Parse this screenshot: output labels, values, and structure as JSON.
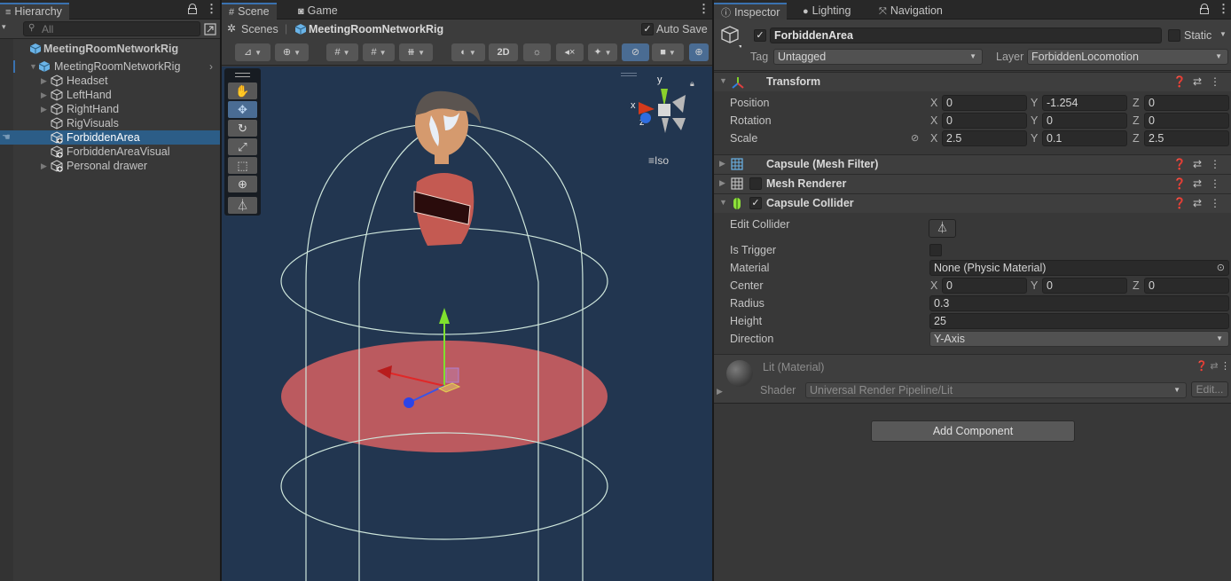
{
  "hierarchy": {
    "tab_label": "Hierarchy",
    "search_placeholder": "All",
    "scene_root": "MeetingRoomNetworkRig",
    "items": [
      {
        "label": "MeetingRoomNetworkRig",
        "expanded": true,
        "prefab": true
      },
      {
        "label": "Headset",
        "collapsed": true,
        "prefab": true
      },
      {
        "label": "LeftHand",
        "collapsed": true,
        "prefab": true
      },
      {
        "label": "RightHand",
        "collapsed": true,
        "prefab": true
      },
      {
        "label": "RigVisuals",
        "prefab": true
      },
      {
        "label": "ForbiddenArea",
        "selected": true,
        "added": true
      },
      {
        "label": "ForbiddenAreaVisual",
        "added": true
      },
      {
        "label": "Personal drawer",
        "collapsed": true,
        "added": true
      }
    ]
  },
  "scene": {
    "tabs": [
      {
        "label": "Scene",
        "icon": "grid-icon",
        "active": true
      },
      {
        "label": "Game",
        "icon": "gamepad-icon",
        "active": false
      }
    ],
    "breadcrumb": {
      "scenes": "Scenes",
      "prefab": "MeetingRoomNetworkRig"
    },
    "auto_save_label": "Auto Save",
    "auto_save_checked": true,
    "toolbar": {
      "mode_2d": "2D"
    },
    "gizmo": {
      "x": "x",
      "y": "y",
      "z": "z",
      "projection": "Iso"
    }
  },
  "inspector": {
    "tabs": [
      {
        "label": "Inspector",
        "icon": "info-icon",
        "active": true
      },
      {
        "label": "Lighting",
        "icon": "bulb-icon",
        "active": false
      },
      {
        "label": "Navigation",
        "icon": "navigation-icon",
        "active": false
      }
    ],
    "object": {
      "active": true,
      "name": "ForbiddenArea",
      "static_label": "Static",
      "static": false,
      "tag_label": "Tag",
      "tag": "Untagged",
      "layer_label": "Layer",
      "layer": "ForbiddenLocomotion"
    },
    "transform": {
      "title": "Transform",
      "position_label": "Position",
      "rotation_label": "Rotation",
      "scale_label": "Scale",
      "position": {
        "x": "0",
        "y": "-1.254",
        "z": "0"
      },
      "rotation": {
        "x": "0",
        "y": "0",
        "z": "0"
      },
      "scale": {
        "x": "2.5",
        "y": "0.1",
        "z": "2.5"
      }
    },
    "mesh_filter": {
      "title": "Capsule (Mesh Filter)"
    },
    "mesh_renderer": {
      "title": "Mesh Renderer",
      "enabled": false
    },
    "capsule_collider": {
      "title": "Capsule Collider",
      "enabled": true,
      "edit_collider_label": "Edit Collider",
      "is_trigger_label": "Is Trigger",
      "is_trigger": false,
      "material_label": "Material",
      "material": "None (Physic Material)",
      "center_label": "Center",
      "center": {
        "x": "0",
        "y": "0",
        "z": "0"
      },
      "radius_label": "Radius",
      "radius": "0.3",
      "height_label": "Height",
      "height": "25",
      "direction_label": "Direction",
      "direction": "Y-Axis"
    },
    "material": {
      "title": "Lit (Material)",
      "shader_label": "Shader",
      "shader": "Universal Render Pipeline/Lit",
      "edit_label": "Edit..."
    },
    "add_component_label": "Add Component",
    "axis_labels": {
      "x": "X",
      "y": "Y",
      "z": "Z"
    }
  }
}
